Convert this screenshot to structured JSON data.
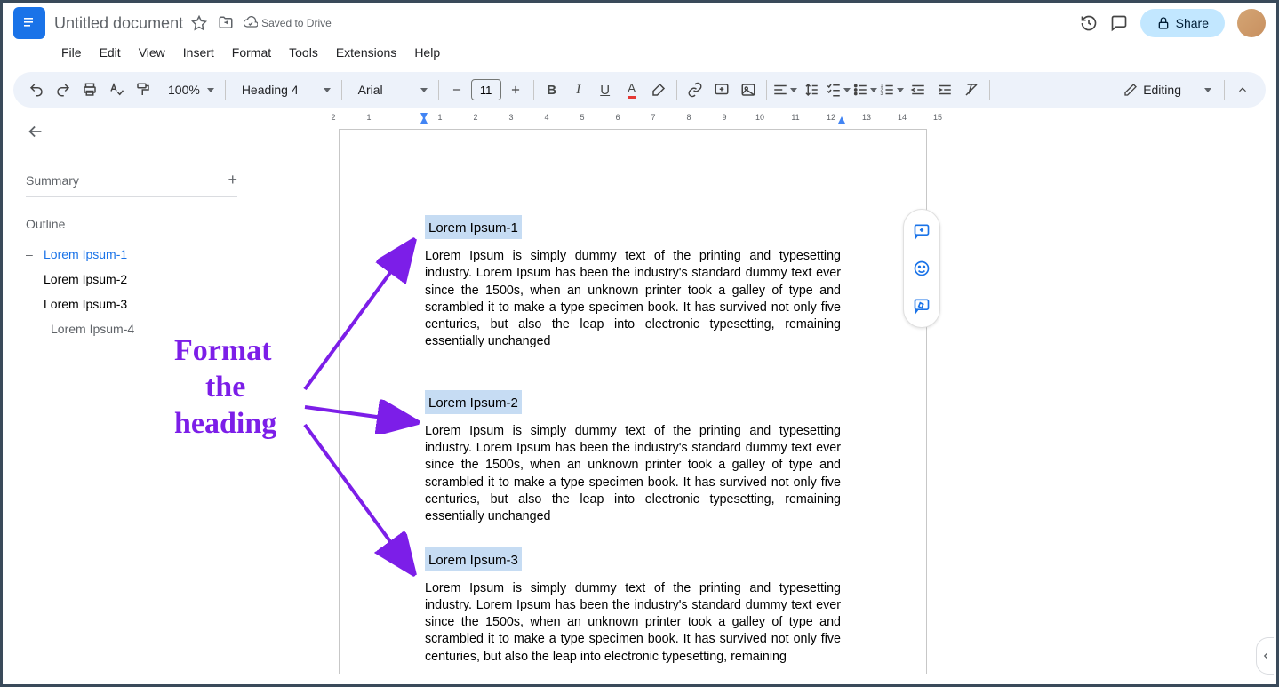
{
  "titlebar": {
    "docTitle": "Untitled document",
    "savedLabel": "Saved to Drive",
    "shareLabel": "Share"
  },
  "menu": {
    "items": [
      "File",
      "Edit",
      "View",
      "Insert",
      "Format",
      "Tools",
      "Extensions",
      "Help"
    ]
  },
  "toolbar": {
    "zoom": "100%",
    "styleName": "Heading 4",
    "font": "Arial",
    "fontSize": "11",
    "editMode": "Editing"
  },
  "sidebar": {
    "summaryLabel": "Summary",
    "outlineLabel": "Outline",
    "items": [
      {
        "label": "Lorem Ipsum-1",
        "active": true,
        "level": 0
      },
      {
        "label": "Lorem Ipsum-2",
        "active": false,
        "level": 0
      },
      {
        "label": "Lorem Ipsum-3",
        "active": false,
        "level": 0
      },
      {
        "label": "Lorem Ipsum-4",
        "active": false,
        "level": 1
      }
    ]
  },
  "document": {
    "sections": [
      {
        "heading": "Lorem Ipsum-1",
        "body": "Lorem Ipsum is simply dummy text of the printing and typesetting industry. Lorem Ipsum has been the industry's standard dummy text ever since the 1500s, when an unknown printer took a galley of type and scrambled it to make a type specimen book. It has survived not only five centuries, but also the leap into electronic typesetting, remaining essentially unchanged"
      },
      {
        "heading": "Lorem Ipsum-2",
        "body": "Lorem Ipsum is simply dummy text of the printing and typesetting industry. Lorem Ipsum has been the industry's standard dummy text ever since the 1500s, when an unknown printer took a galley of type and scrambled it to make a type specimen book. It has survived not only five centuries, but also the leap into electronic typesetting, remaining essentially unchanged"
      },
      {
        "heading": "Lorem Ipsum-3",
        "body": "Lorem Ipsum is simply dummy text of the printing and typesetting industry. Lorem Ipsum has been the industry's standard dummy text ever since the 1500s, when an unknown printer took a galley of type and scrambled it to make a type specimen book. It has survived not only five centuries, but also the leap into electronic typesetting, remaining"
      }
    ]
  },
  "annotation": {
    "text1": "Format",
    "text2": "the",
    "text3": "heading"
  },
  "ruler": {
    "marks": [
      "2",
      "1",
      "",
      "1",
      "2",
      "3",
      "4",
      "5",
      "6",
      "7",
      "8",
      "9",
      "10",
      "11",
      "12",
      "13",
      "14",
      "15"
    ]
  }
}
